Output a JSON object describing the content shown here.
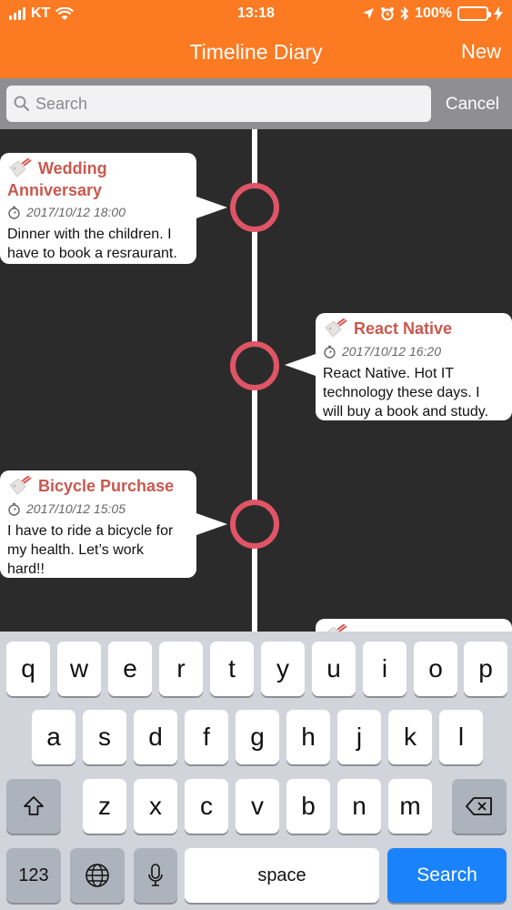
{
  "status": {
    "carrier": "KT",
    "time": "13:18",
    "battery": "100%",
    "battery_level": 1.0
  },
  "nav": {
    "title": "Timeline Diary",
    "new_label": "New"
  },
  "search": {
    "placeholder": "Search",
    "cancel_label": "Cancel"
  },
  "entries": [
    {
      "title_line1": "Wedding",
      "title_line2": "Anniversary",
      "date": "2017/10/12 18:00",
      "body_line1": "Dinner with the children. I",
      "body_line2": "have to book a resraurant.",
      "body_line3": ""
    },
    {
      "title_line1": "React Native",
      "date": "2017/10/12 16:20",
      "body_line1": "React Native. Hot IT",
      "body_line2": "technology these days. I",
      "body_line3": "will buy a book and study."
    },
    {
      "title_line1": "Bicycle Purchase",
      "date": "2017/10/12 15:05",
      "body_line1": "I have to ride a bicycle for",
      "body_line2": "my health. Let’s work",
      "body_line3": "hard!!"
    }
  ],
  "keyboard": {
    "row1": [
      "q",
      "w",
      "e",
      "r",
      "t",
      "y",
      "u",
      "i",
      "o",
      "p"
    ],
    "row2": [
      "a",
      "s",
      "d",
      "f",
      "g",
      "h",
      "j",
      "k",
      "l"
    ],
    "row3": [
      "z",
      "x",
      "c",
      "v",
      "b",
      "n",
      "m"
    ],
    "numbers_label": "123",
    "space_label": "space",
    "search_label": "Search"
  },
  "colors": {
    "accent": "#fb7a22",
    "node": "#e05566",
    "entry_title": "#c9584e",
    "search_key": "#1a82fb"
  }
}
